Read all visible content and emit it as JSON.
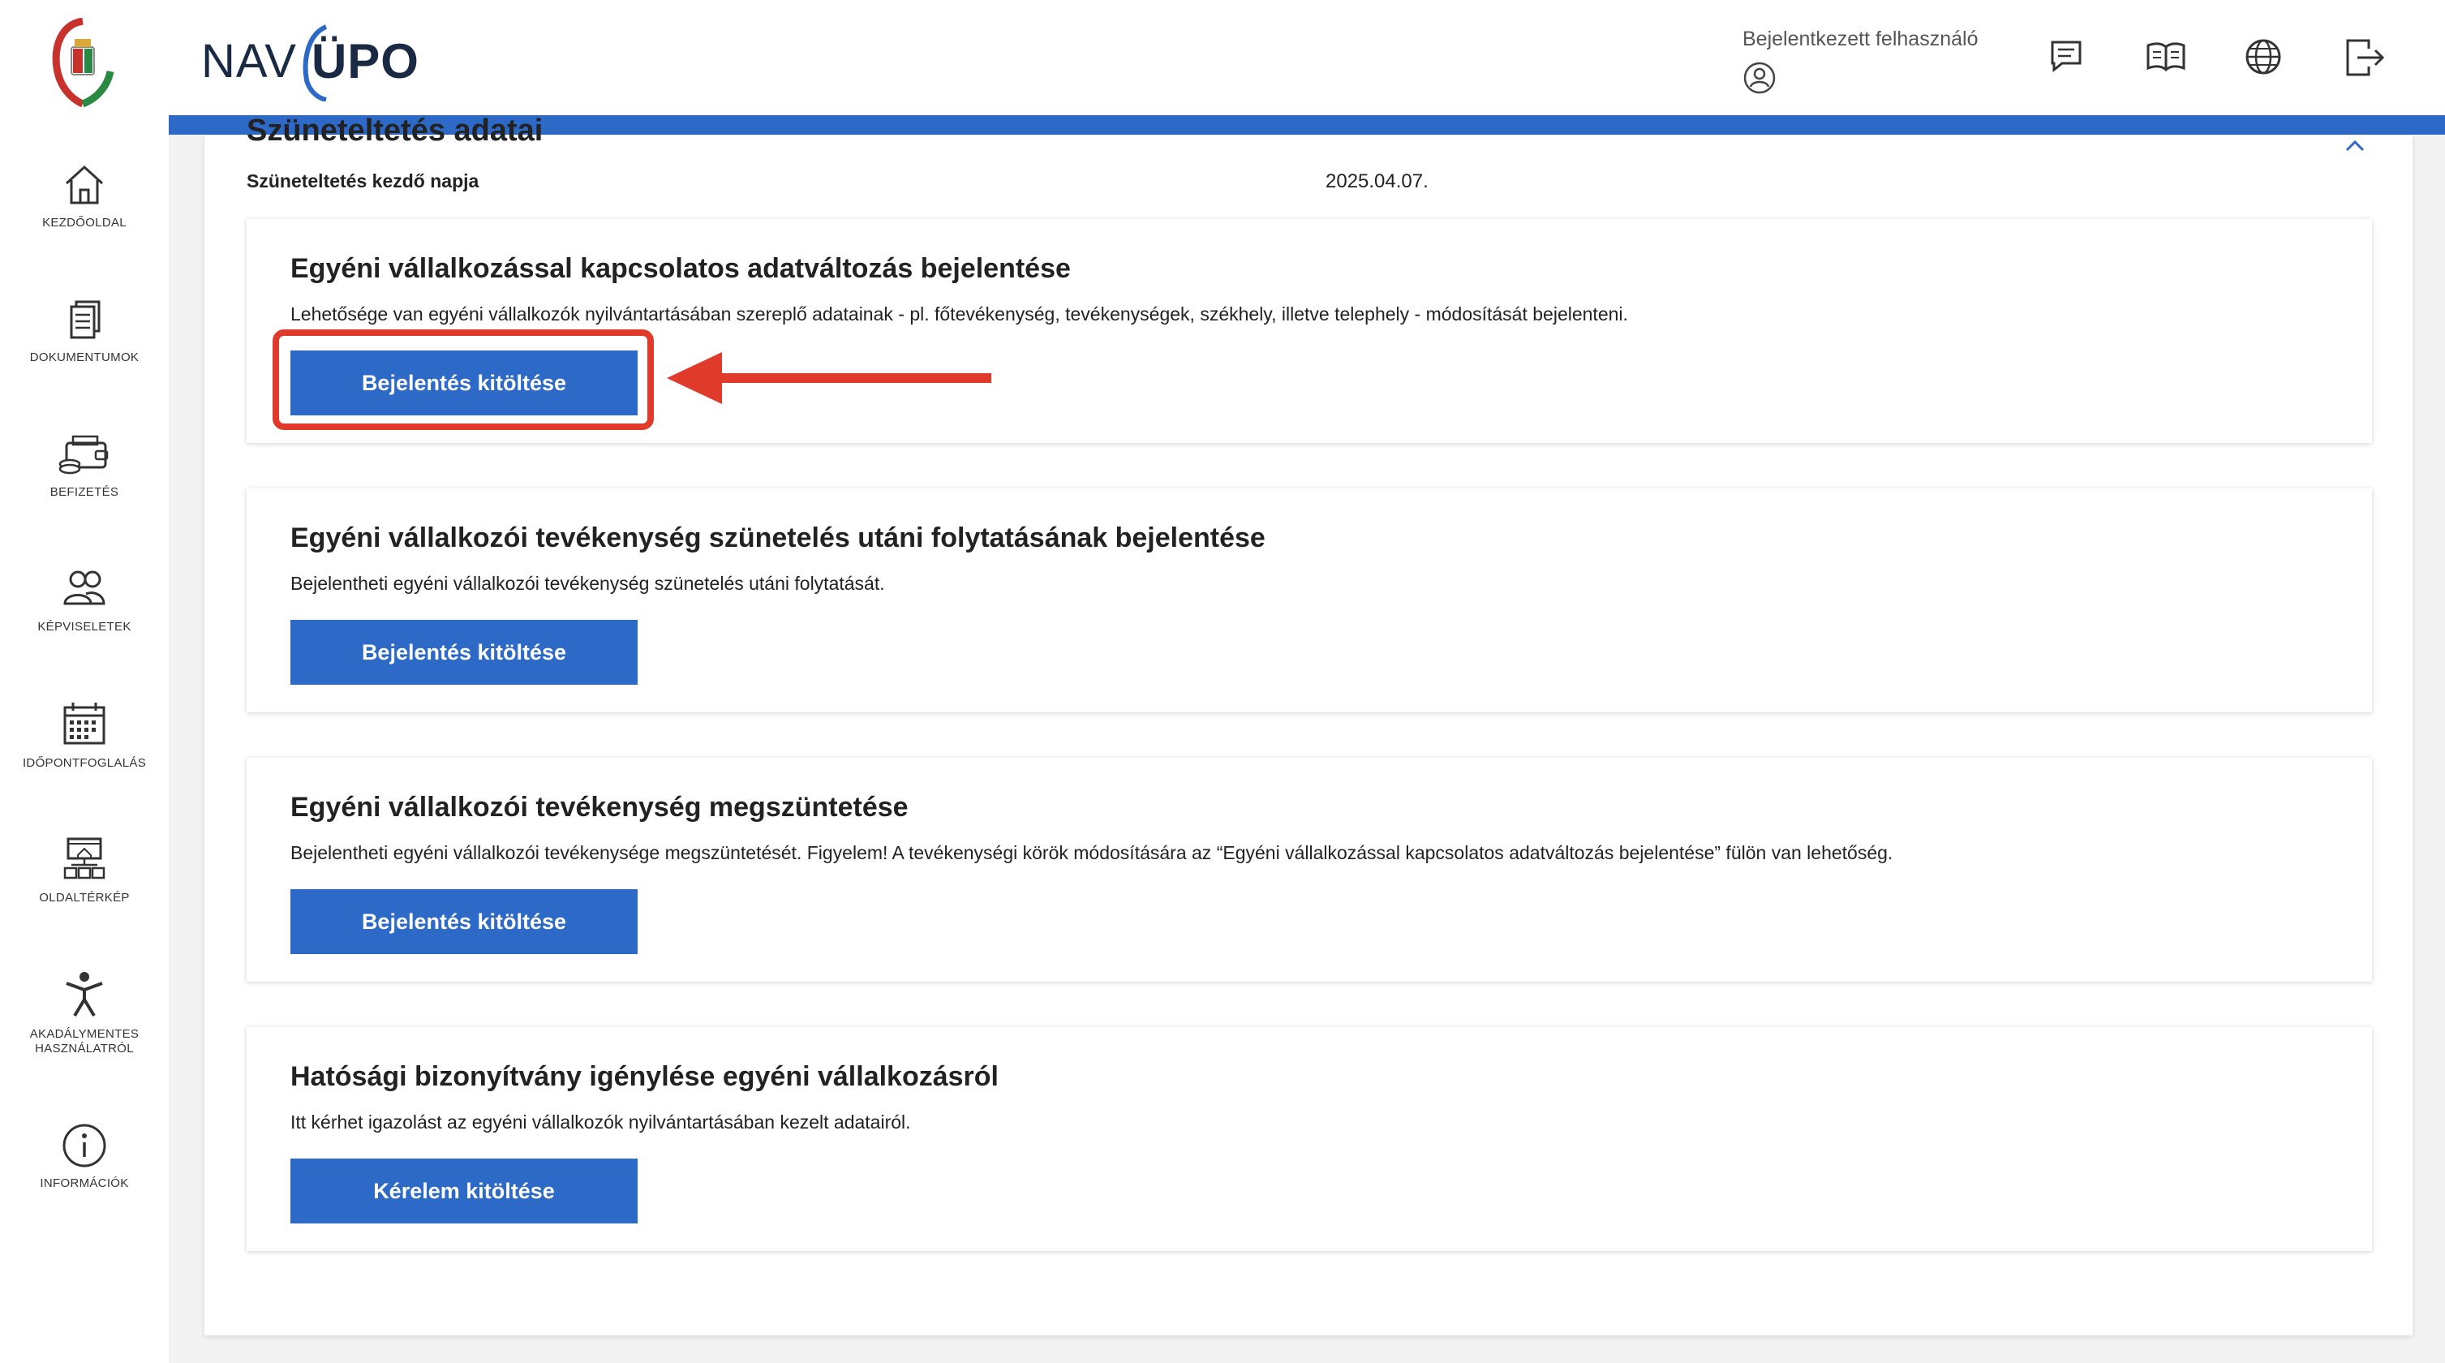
{
  "sidebar": {
    "items": [
      {
        "label": "KEZDŐOLDAL",
        "icon": "home-icon"
      },
      {
        "label": "DOKUMENTUMOK",
        "icon": "documents-icon"
      },
      {
        "label": "BEFIZETÉS",
        "icon": "payment-icon"
      },
      {
        "label": "KÉPVISELETEK",
        "icon": "users-icon"
      },
      {
        "label": "IDŐPONTFOGLALÁS",
        "icon": "calendar-icon"
      },
      {
        "label": "OLDALTÉRKÉP",
        "icon": "sitemap-icon"
      },
      {
        "label": "AKADÁLYMENTES HASZNÁLATRÓL",
        "icon": "accessibility-icon"
      },
      {
        "label": "INFORMÁCIÓK",
        "icon": "info-icon"
      }
    ]
  },
  "header": {
    "brand_nav": "NAV",
    "brand_upo": "ÜPO",
    "user_label": "Bejelentkezett felhasználó",
    "icons": [
      "message-icon",
      "book-icon",
      "globe-icon",
      "logout-icon"
    ],
    "accent_color": "#2d69c6"
  },
  "main": {
    "section_title": "Szüneteltetés adatai",
    "start_label": "Szüneteltetés kezdő napja",
    "start_value": "2025.04.07.",
    "cards": [
      {
        "title": "Egyéni vállalkozással kapcsolatos adatváltozás bejelentése",
        "text": "Lehetősége van egyéni vállalkozók nyilvántartásában szereplő adatainak - pl. főtevékenység, tevékenységek, székhely, illetve telephely - módosítását bejelenteni.",
        "button": "Bejelentés kitöltése"
      },
      {
        "title": "Egyéni vállalkozói tevékenység szünetelés utáni folytatásának bejelentése",
        "text": "Bejelentheti egyéni vállalkozói tevékenység szünetelés utáni folytatását.",
        "button": "Bejelentés kitöltése"
      },
      {
        "title": "Egyéni vállalkozói tevékenység megszüntetése",
        "text": "Bejelentheti egyéni vállalkozói tevékenysége megszüntetését. Figyelem! A tevékenységi körök módosítására az “Egyéni vállalkozással kapcsolatos adatváltozás bejelentése” fülön van lehetőség.",
        "button": "Bejelentés kitöltése"
      },
      {
        "title": "Hatósági bizonyítvány igénylése egyéni vállalkozásról",
        "text": "Itt kérhet igazolást az egyéni vállalkozók nyilvántartásában kezelt adatairól.",
        "button": "Kérelem kitöltése"
      }
    ],
    "annotation_color": "#e03a2a"
  }
}
